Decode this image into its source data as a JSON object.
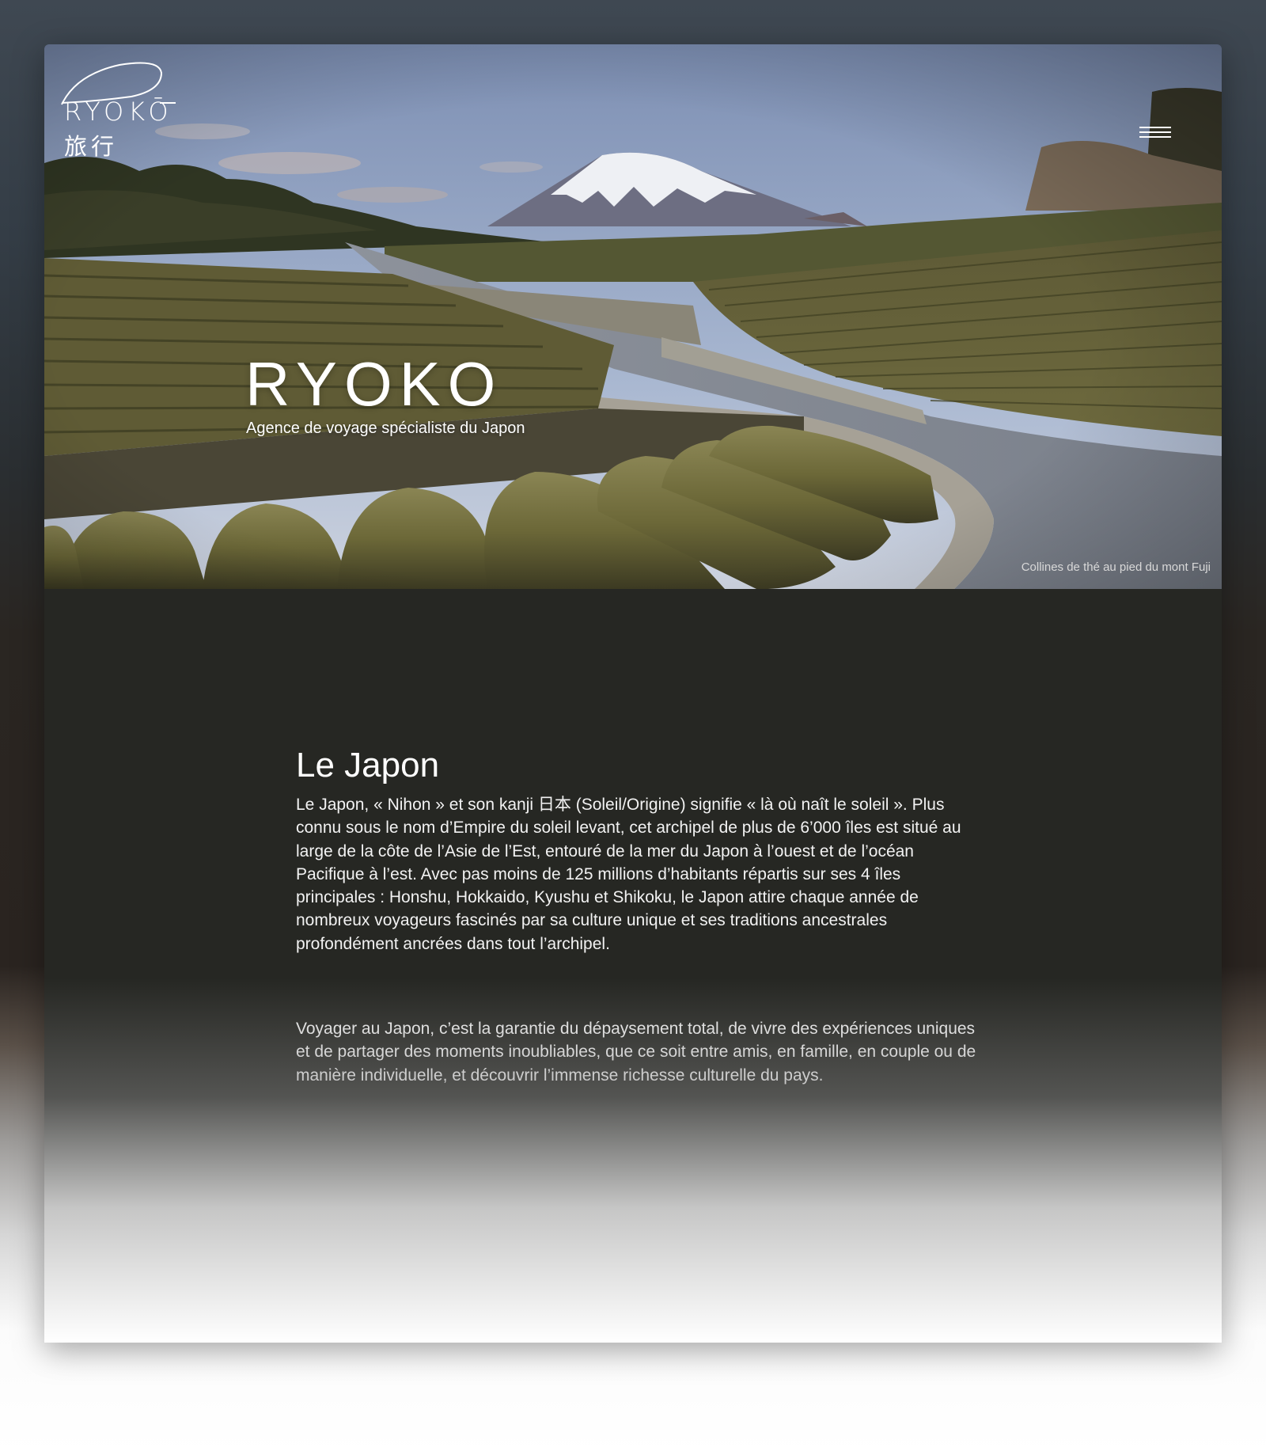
{
  "brand": {
    "logo_text": "RYOKŌ",
    "logo_kanji": "旅行"
  },
  "header": {
    "menu_icon": "hamburger-menu-icon"
  },
  "hero": {
    "title": "RYOKO",
    "subtitle": "Agence de voyage spécialiste du Japon",
    "caption": "Collines de thé au pied du mont Fuji"
  },
  "section": {
    "title": "Le Japon",
    "paragraphs": [
      "Le Japon, « Nihon » et son kanji  日本 (Soleil/Origine) signifie « là où naît le soleil ». Plus connu sous le nom d’Empire du soleil levant, cet archipel de plus de 6’000 îles est situé au large de la côte de l’Asie de l’Est, entouré de la mer du Japon à l’ouest et de l’océan Pacifique à l’est. Avec pas moins de 125 millions d’habitants répartis sur ses 4 îles principales : Honshu, Hokkaido, Kyushu et Shikoku, le Japon attire chaque année de nombreux voyageurs fascinés par sa culture unique et ses traditions ancestrales profondément ancrées dans tout l’archipel.",
      "Voyager au Japon, c’est la garantie du dépaysement total, de vivre des expériences uniques et de partager des moments inoubliables, que ce soit entre amis, en famille, en couple ou de manière individuelle, et découvrir l’immense richesse culturelle du pays."
    ]
  },
  "colors": {
    "content_background": "#262723",
    "text": "#ffffff",
    "caption": "#d8d8d8"
  }
}
